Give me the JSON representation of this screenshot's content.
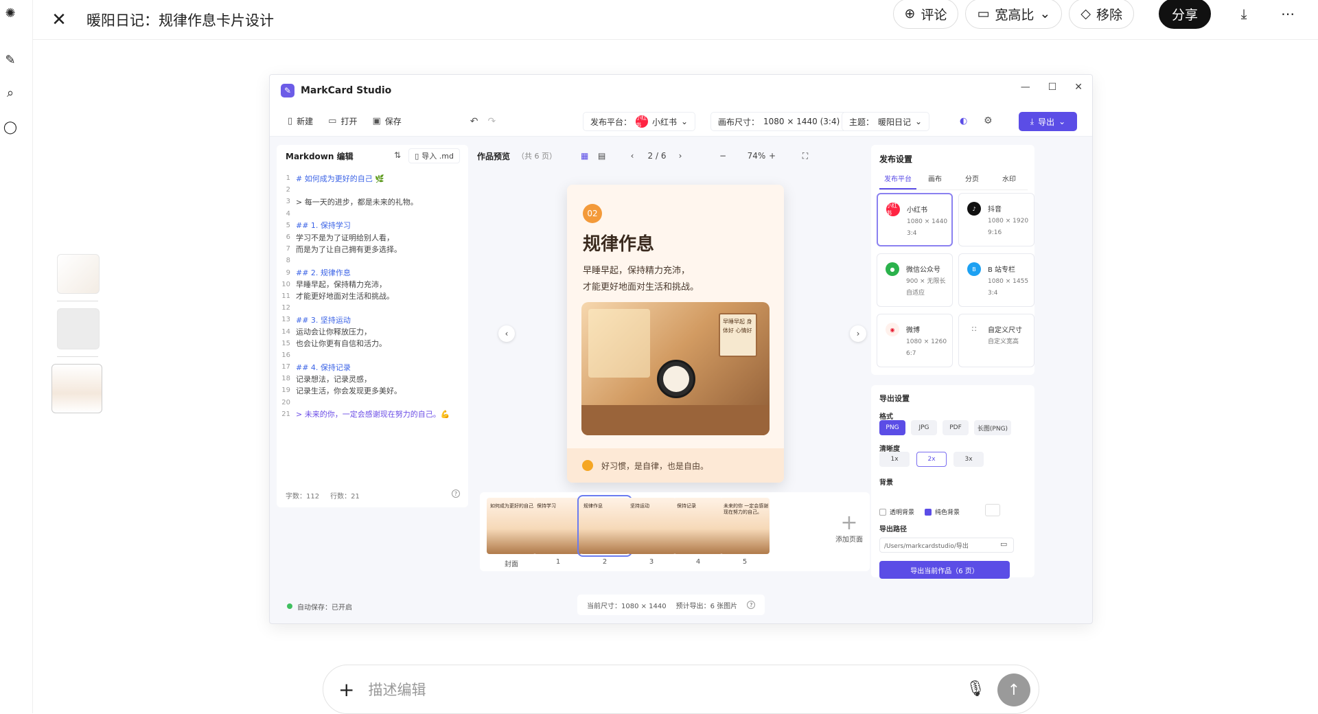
{
  "topbar": {
    "title": "暖阳日记：规律作息卡片设计",
    "comment": "评论",
    "ratio": "宽高比",
    "remove": "移除",
    "share": "分享"
  },
  "app": {
    "title": "MarkCard Studio",
    "toolbar": {
      "new": "新建",
      "open": "打开",
      "save": "保存",
      "platform_label": "发布平台：",
      "platform_value": "小红书",
      "canvas_label": "画布尺寸：",
      "canvas_value": "1080 × 1440 (3:4)",
      "theme_label": "主题：",
      "theme_value": "暖阳日记",
      "export": "导出",
      "xhs_badge": "小红书"
    },
    "editor": {
      "title": "Markdown 编辑",
      "import": "导入 .md",
      "lines": [
        {
          "n": "1",
          "t": "# 如何成为更好的自己 🌿",
          "k": "h"
        },
        {
          "n": "2",
          "t": "",
          "k": ""
        },
        {
          "n": "3",
          "t": "> 每一天的进步，都是未来的礼物。",
          "k": ""
        },
        {
          "n": "4",
          "t": "",
          "k": ""
        },
        {
          "n": "5",
          "t": "## 1. 保持学习",
          "k": "h"
        },
        {
          "n": "6",
          "t": "学习不是为了证明给别人看，",
          "k": ""
        },
        {
          "n": "7",
          "t": "而是为了让自己拥有更多选择。",
          "k": ""
        },
        {
          "n": "8",
          "t": "",
          "k": ""
        },
        {
          "n": "9",
          "t": "## 2. 规律作息",
          "k": "h"
        },
        {
          "n": "10",
          "t": "早睡早起，保持精力充沛，",
          "k": ""
        },
        {
          "n": "11",
          "t": "才能更好地面对生活和挑战。",
          "k": ""
        },
        {
          "n": "12",
          "t": "",
          "k": ""
        },
        {
          "n": "13",
          "t": "## 3. 坚持运动",
          "k": "h"
        },
        {
          "n": "14",
          "t": "运动会让你释放压力，",
          "k": ""
        },
        {
          "n": "15",
          "t": "也会让你更有自信和活力。",
          "k": ""
        },
        {
          "n": "16",
          "t": "",
          "k": ""
        },
        {
          "n": "17",
          "t": "## 4. 保持记录",
          "k": "h"
        },
        {
          "n": "18",
          "t": "记录想法，记录灵感，",
          "k": ""
        },
        {
          "n": "19",
          "t": "记录生活，你会发现更多美好。",
          "k": ""
        },
        {
          "n": "20",
          "t": "",
          "k": ""
        },
        {
          "n": "21",
          "t": "> 未来的你，一定会感谢现在努力的自己。💪",
          "k": "q"
        }
      ],
      "chars": "字数：112",
      "rows": "行数：21"
    },
    "preview": {
      "title": "作品预览",
      "count": "（共 6 页）",
      "page": "2 / 6",
      "zoom": "74%"
    },
    "card": {
      "num": "02",
      "heading": "规律作息",
      "line1": "早睡早起，保持精力充沛，",
      "line2": "才能更好地面对生活和挑战。",
      "sign": "早睡早起 身体好 心情好",
      "footer": "好习惯，是自律，也是自由。"
    },
    "strip": {
      "pages": [
        {
          "label": "封面",
          "text": "如何成为更好的自己"
        },
        {
          "label": "1",
          "text": "保持学习"
        },
        {
          "label": "2",
          "text": "规律作息"
        },
        {
          "label": "3",
          "text": "坚持运动"
        },
        {
          "label": "4",
          "text": "保持记录"
        },
        {
          "label": "5",
          "text": "未来的你 一定会感谢 现在努力的自己。"
        }
      ],
      "add": "添加页面"
    },
    "publish": {
      "title": "发布设置",
      "tabs": [
        "发布平台",
        "画布",
        "分页",
        "水印"
      ],
      "platforms": [
        {
          "name": "小红书",
          "size": "1080 × 1440",
          "ratio": "3:4",
          "badge": "小红书"
        },
        {
          "name": "抖音",
          "size": "1080 × 1920",
          "ratio": "9:16",
          "badge": "♪"
        },
        {
          "name": "微信公众号",
          "size": "900 × 无限长",
          "ratio": "自适应",
          "badge": "●"
        },
        {
          "name": "B 站专栏",
          "size": "1080 × 1455",
          "ratio": "3:4",
          "badge": "B"
        },
        {
          "name": "微博",
          "size": "1080 × 1260",
          "ratio": "6:7",
          "badge": "◉"
        },
        {
          "name": "自定义尺寸",
          "size": "自定义宽高",
          "ratio": "",
          "badge": "⛶"
        }
      ]
    },
    "export": {
      "title": "导出设置",
      "format_label": "格式",
      "formats": [
        "PNG",
        "JPG",
        "PDF",
        "长图(PNG)"
      ],
      "clarity_label": "清晰度",
      "clarity": [
        "1x",
        "2x",
        "3x"
      ],
      "bg_label": "背景",
      "transparent": "透明背景",
      "solid": "纯色背景",
      "path_label": "导出路径",
      "path": "/Users/markcardstudio/导出",
      "button": "导出当前作品（6 页）"
    },
    "status": {
      "autosave": "自动保存：已开启",
      "size": "当前尺寸：1080 × 1440",
      "estimate": "预计导出：6 张图片"
    }
  },
  "chat": {
    "placeholder": "描述编辑"
  },
  "colors": {
    "accent": "#5b4de6",
    "xhs": "#ff2442",
    "warm": "#f39a3a"
  }
}
